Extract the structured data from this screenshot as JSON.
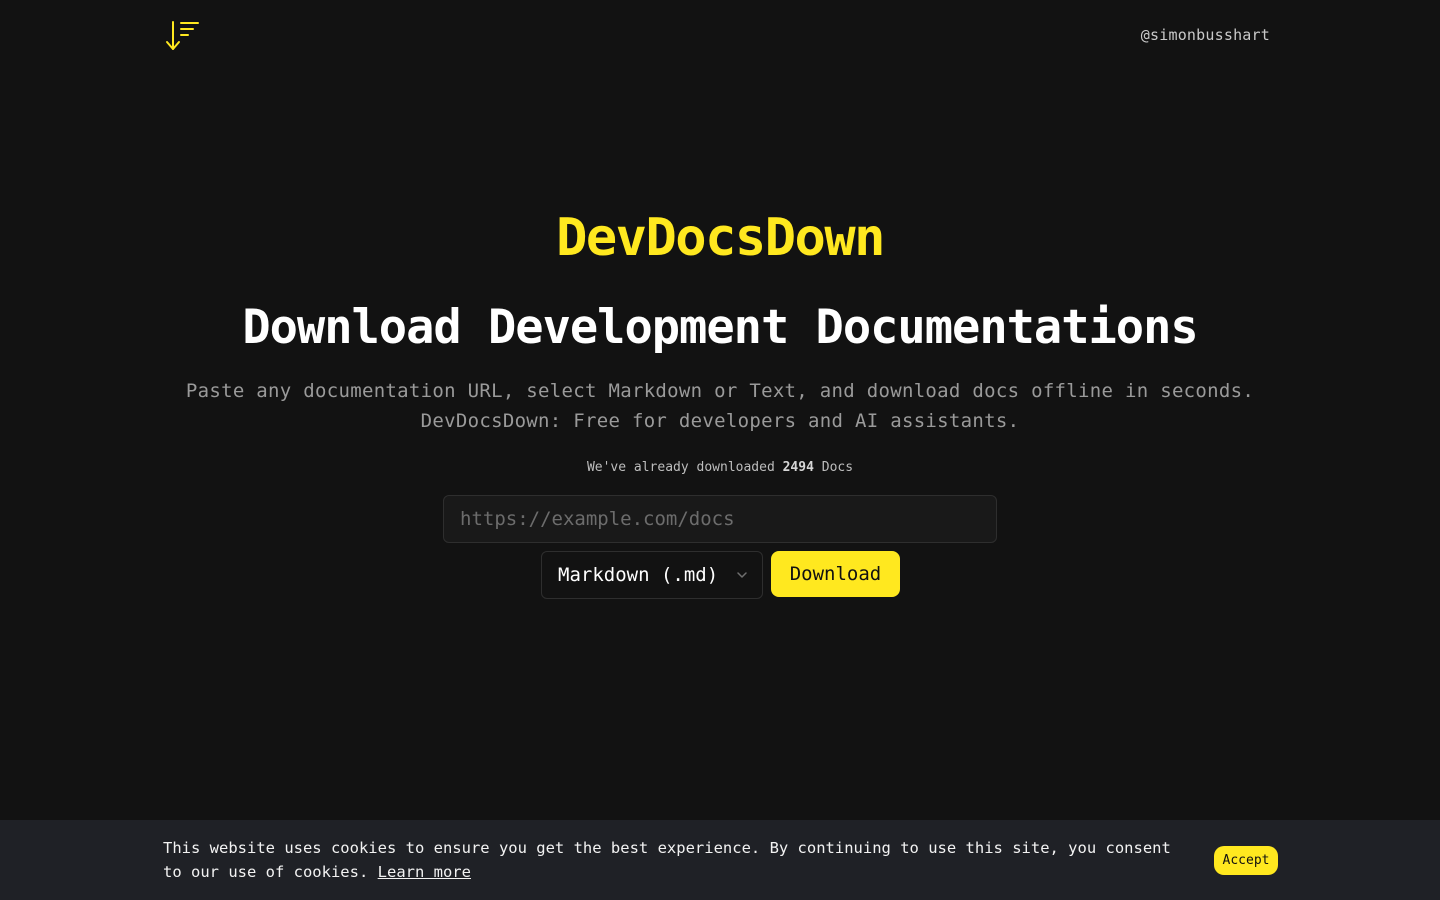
{
  "header": {
    "logo_icon": "sort-download-arrow-icon",
    "handle": "@simonbusshart"
  },
  "hero": {
    "brand": "DevDocsDown",
    "headline": "Download Development Documentations",
    "subtitle_line1": "Paste any documentation URL, select Markdown or Text, and download docs offline in seconds.",
    "subtitle_line2": "DevDocsDown: Free for developers and AI assistants.",
    "counter_prefix": "We've already downloaded",
    "counter_value": "2494",
    "counter_suffix": "Docs"
  },
  "form": {
    "url_value": "",
    "url_placeholder": "https://example.com/docs",
    "format_selected": "Markdown (.md)",
    "download_label": "Download"
  },
  "cookie_banner": {
    "message": "This website uses cookies to ensure you get the best experience. By continuing to use this site, you consent to our use of cookies.",
    "learn_more": "Learn more",
    "accept_label": "Accept"
  },
  "colors": {
    "accent": "#ffe81f",
    "background": "#121212",
    "banner": "#1f2126"
  }
}
